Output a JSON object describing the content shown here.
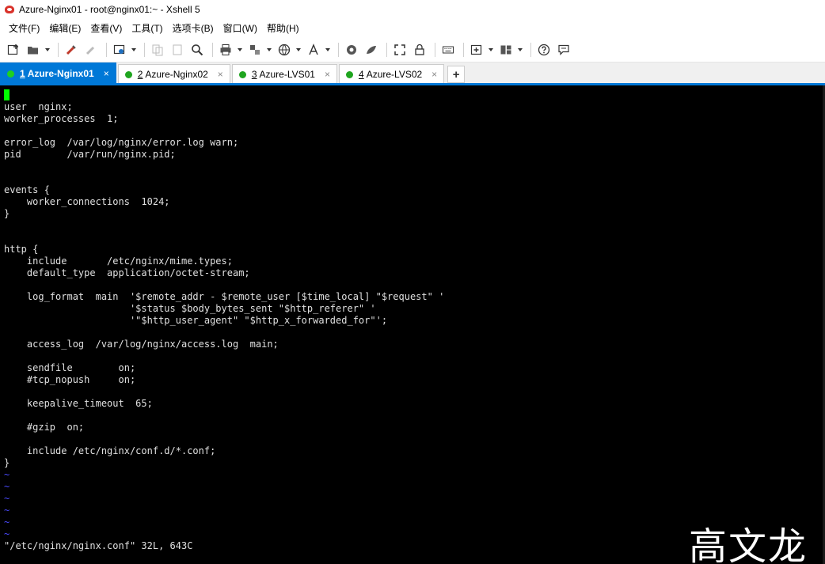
{
  "window": {
    "title": "Azure-Nginx01 - root@nginx01:~ - Xshell 5"
  },
  "menu": [
    {
      "label": "文件(F)"
    },
    {
      "label": "编辑(E)"
    },
    {
      "label": "查看(V)"
    },
    {
      "label": "工具(T)"
    },
    {
      "label": "选项卡(B)"
    },
    {
      "label": "窗口(W)"
    },
    {
      "label": "帮助(H)"
    }
  ],
  "toolbar": {
    "icons": [
      "new-session-icon",
      "open-folder-icon",
      "reconnect-icon",
      "disconnect-icon",
      "properties-icon",
      "copy-icon",
      "paste-icon",
      "find-icon",
      "print-icon",
      "transfer-icon",
      "globe-icon",
      "font-icon",
      "xftp-icon",
      "xmanager-icon",
      "fullscreen-icon",
      "lock-icon",
      "keyboard-icon",
      "new-tab-icon",
      "layout-icon",
      "help-icon",
      "chat-icon"
    ]
  },
  "tabs": [
    {
      "num": "1",
      "label": "Azure-Nginx01",
      "active": true
    },
    {
      "num": "2",
      "label": "Azure-Nginx02",
      "active": false
    },
    {
      "num": "3",
      "label": "Azure-LVS01",
      "active": false
    },
    {
      "num": "4",
      "label": "Azure-LVS02",
      "active": false
    }
  ],
  "tab_add_label": "+",
  "tab_close_label": "×",
  "terminal": {
    "lines": [
      "user  nginx;",
      "worker_processes  1;",
      "",
      "error_log  /var/log/nginx/error.log warn;",
      "pid        /var/run/nginx.pid;",
      "",
      "",
      "events {",
      "    worker_connections  1024;",
      "}",
      "",
      "",
      "http {",
      "    include       /etc/nginx/mime.types;",
      "    default_type  application/octet-stream;",
      "",
      "    log_format  main  '$remote_addr - $remote_user [$time_local] \"$request\" '",
      "                      '$status $body_bytes_sent \"$http_referer\" '",
      "                      '\"$http_user_agent\" \"$http_x_forwarded_for\"';",
      "",
      "    access_log  /var/log/nginx/access.log  main;",
      "",
      "    sendfile        on;",
      "    #tcp_nopush     on;",
      "",
      "    keepalive_timeout  65;",
      "",
      "    #gzip  on;",
      "",
      "    include /etc/nginx/conf.d/*.conf;",
      "}"
    ],
    "tildes": [
      "~",
      "~",
      "~",
      "~",
      "~",
      "~"
    ],
    "status": "\"/etc/nginx/nginx.conf\" 32L, 643C"
  },
  "watermark": "高文龙",
  "colors": {
    "accent": "#0078d7",
    "session_dot": "#1fa51f",
    "cursor": "#00ff00",
    "terminal_bg": "#000000"
  }
}
